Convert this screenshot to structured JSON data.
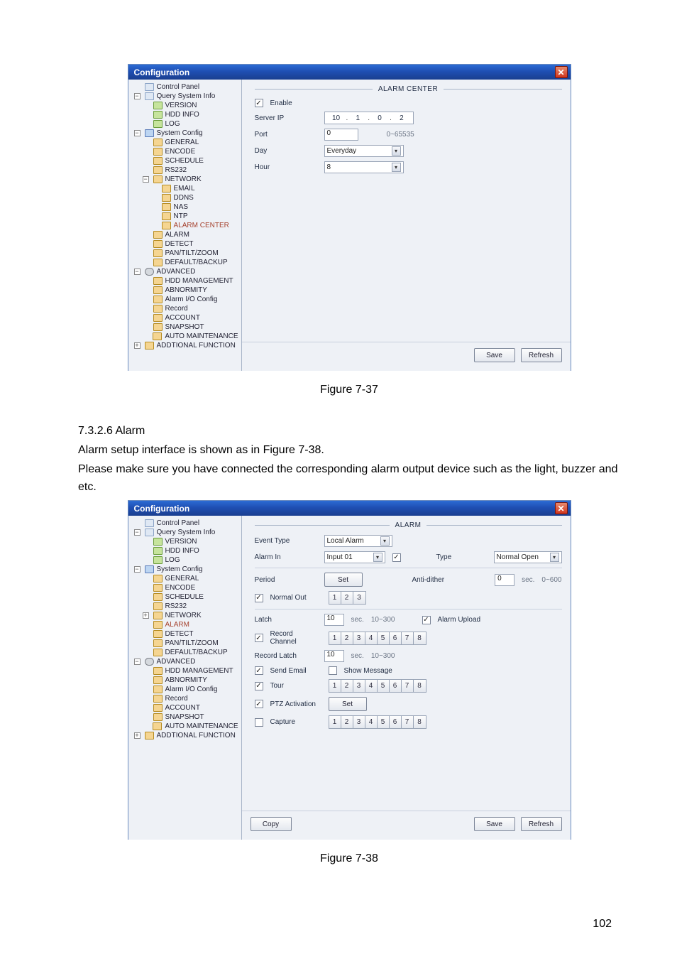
{
  "window_title": "Configuration",
  "close_glyph": "✕",
  "tree": {
    "root": "Control Panel",
    "query": "Query System Info",
    "version": "VERSION",
    "hdd_info": "HDD INFO",
    "log": "LOG",
    "system_config": "System Config",
    "general": "GENERAL",
    "encode": "ENCODE",
    "schedule": "SCHEDULE",
    "rs232": "RS232",
    "network": "NETWORK",
    "email": "EMAIL",
    "ddns": "DDNS",
    "nas": "NAS",
    "ntp": "NTP",
    "alarm_center": "ALARM CENTER",
    "alarm": "ALARM",
    "detect": "DETECT",
    "ptz": "PAN/TILT/ZOOM",
    "default_backup": "DEFAULT/BACKUP",
    "advanced": "ADVANCED",
    "hdd_management": "HDD MANAGEMENT",
    "abnormity": "ABNORMITY",
    "alarm_io": "Alarm I/O Config",
    "record": "Record",
    "account": "ACCOUNT",
    "snapshot": "SNAPSHOT",
    "auto_maintenance": "AUTO MAINTENANCE",
    "additional": "ADDTIONAL FUNCTION"
  },
  "fig37": {
    "section_heading": "ALARM CENTER",
    "enable_label": "Enable",
    "server_ip_label": "Server IP",
    "server_ip": [
      "10",
      "1",
      "0",
      "2"
    ],
    "port_label": "Port",
    "port_value": "0",
    "port_range": "0~65535",
    "day_label": "Day",
    "day_value": "Everyday",
    "hour_label": "Hour",
    "hour_value": "8",
    "save": "Save",
    "refresh": "Refresh"
  },
  "fig38": {
    "section_heading": "ALARM",
    "event_type_label": "Event Type",
    "event_type_value": "Local Alarm",
    "alarm_in_label": "Alarm In",
    "alarm_in_value": "Input 01",
    "alarm_in_check": "✓",
    "type_label": "Type",
    "type_value": "Normal Open",
    "period_label": "Period",
    "period_set": "Set",
    "anti_dither_label": "Anti-dither",
    "anti_dither_value": "0",
    "anti_dither_unit": "sec.",
    "anti_dither_range": "0~600",
    "normal_out_label": "Normal Out",
    "channels3": [
      "1",
      "2",
      "3"
    ],
    "latch_label": "Latch",
    "latch_value": "10",
    "latch_unit": "sec.",
    "latch_range": "10~300",
    "alarm_upload_label": "Alarm Upload",
    "record_channel_label": "Record Channel",
    "channels8": [
      "1",
      "2",
      "3",
      "4",
      "5",
      "6",
      "7",
      "8"
    ],
    "record_latch_label": "Record Latch",
    "record_latch_value": "10",
    "record_latch_unit": "sec.",
    "record_latch_range": "10~300",
    "send_email_label": "Send Email",
    "show_message_label": "Show Message",
    "tour_label": "Tour",
    "ptz_activation_label": "PTZ Activation",
    "ptz_set": "Set",
    "capture_label": "Capture",
    "copy": "Copy",
    "save": "Save",
    "refresh": "Refresh"
  },
  "captions": {
    "fig37": "Figure 7-37",
    "fig38": "Figure 7-38"
  },
  "text": {
    "heading": "7.3.2.6  Alarm",
    "line1": "Alarm setup interface is shown as in Figure 7-38.",
    "line2": "Please make sure you have connected the corresponding alarm output device such as the light, buzzer and etc."
  },
  "page_number": "102"
}
